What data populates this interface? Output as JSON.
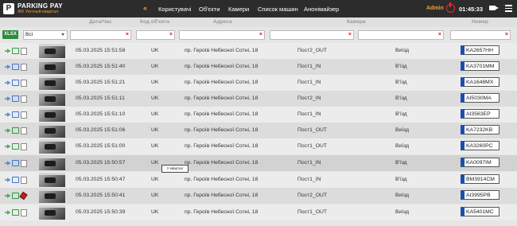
{
  "app": {
    "brand": "PARKING PAY",
    "subtitle": "ЖК Уютный квартал",
    "logo_letter": "P"
  },
  "nav": [
    "Користувачі",
    "Об'єкти",
    "Камери",
    "Список машин",
    "Анонімайзер"
  ],
  "user": {
    "name": "Admin",
    "time": "01:45:33"
  },
  "columns": {
    "date": "Дата/Час",
    "code": "Код об'єкта",
    "address": "Адреса",
    "camera": "Камера",
    "plate": "Номер"
  },
  "toolbar": {
    "export_label": "XLSX",
    "filter_select": "Всі"
  },
  "filter_clear_glyph": "×",
  "rows": [
    {
      "date": "05.03.2025 15:51:58",
      "code": "UK",
      "address": "пр. Героїв Небесної Сотні, 18",
      "camera": "Пост2_OUT",
      "direction": "Виїзд",
      "plate": "KA2657HH"
    },
    {
      "date": "05.03.2025 15:51:40",
      "code": "UK",
      "address": "пр. Героїв Небесної Сотні, 18",
      "camera": "Пост1_IN",
      "direction": "В'їзд",
      "plate": "KA3701MM"
    },
    {
      "date": "05.03.2025 15:51:21",
      "code": "UK",
      "address": "пр. Героїв Небесної Сотні, 18",
      "camera": "Пост1_IN",
      "direction": "В'їзд",
      "plate": "KA1648MX"
    },
    {
      "date": "05.03.2025 15:51:11",
      "code": "UK",
      "address": "пр. Героїв Небесної Сотні, 18",
      "camera": "Пост2_IN",
      "direction": "В'їзд",
      "plate": "AI5030MA"
    },
    {
      "date": "05.03.2025 15:51:10",
      "code": "UK",
      "address": "пр. Героїв Небесної Сотні, 18",
      "camera": "Пост1_IN",
      "direction": "В'їзд",
      "plate": "AI3563EP"
    },
    {
      "date": "05.03.2025 15:51:06",
      "code": "UK",
      "address": "пр. Героїв Небесної Сотні, 18",
      "camera": "Пост1_OUT",
      "direction": "Виїзд",
      "plate": "KA7232KB"
    },
    {
      "date": "05.03.2025 15:51:00",
      "code": "UK",
      "address": "пр. Героїв Небесної Сотні, 18",
      "camera": "Пост1_OUT",
      "direction": "Виїзд",
      "plate": "KA3260PC"
    },
    {
      "date": "05.03.2025 15:50:57",
      "code": "UK",
      "address": "пр. Героїв Небесної Сотні, 18",
      "camera": "Пост1_IN",
      "direction": "В'їзд",
      "plate": "KA0097IM"
    },
    {
      "date": "05.03.2025 15:50:47",
      "code": "UK",
      "address": "пр. Героїв Небесної Сотні, 18",
      "camera": "Пост1_IN",
      "direction": "В'їзд",
      "plate": "BM3914CM"
    },
    {
      "date": "05.03.2025 15:50:41",
      "code": "UK",
      "address": "пр. Героїв Небесної Сотні, 18",
      "camera": "Пост2_OUT",
      "direction": "Виїзд",
      "plate": "AI3995PB"
    },
    {
      "date": "05.03.2025 15:50:39",
      "code": "UK",
      "address": "пр. Героїв Небесної Сотні, 18",
      "camera": "Пост1_OUT",
      "direction": "Виїзд",
      "plate": "KA5401MC"
    }
  ],
  "tooltip": "У квартал",
  "colors": {
    "topbar": "#2c2c2c",
    "accent": "#f0a030",
    "export": "#2e8b3d",
    "plate_strip": "#1c4fa8",
    "clear": "#d02020"
  },
  "icons": [
    "play-icon",
    "folder-icon",
    "file-icon",
    "power-icon",
    "camera-icon",
    "menu-icon",
    "chevron-left-icon"
  ]
}
